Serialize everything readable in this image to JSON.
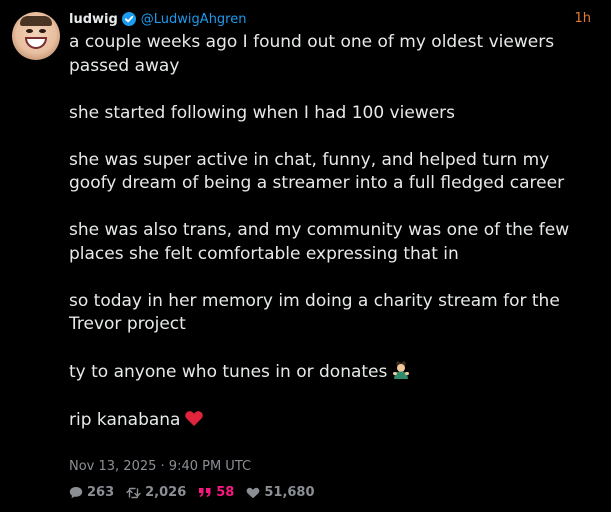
{
  "post": {
    "author_name": "ludwig",
    "author_handle": "@LudwigAhgren",
    "relative_time": "1h",
    "paragraphs": [
      "a couple weeks ago I found out one of my oldest viewers passed away",
      "she started following when I had 100 viewers",
      "she was super active in chat, funny, and helped turn my goofy dream of being a streamer into a full fledged career",
      "she was also trans, and my community was one of the few places she felt comfortable expressing that in",
      "so today in her memory im doing a charity stream for the Trevor project",
      "ty to anyone who tunes in or donates",
      "rip kanabana"
    ],
    "timestamp": "Nov 13, 2025 · 9:40 PM UTC",
    "stats": {
      "replies": "263",
      "reposts": "2,026",
      "quotes": "58",
      "likes": "51,680"
    }
  },
  "icons": {
    "verified": "verified-badge-icon",
    "person_emoji": "man-gesturing-emoji-icon",
    "heart_emoji": "red-heart-emoji-icon",
    "reply": "comment-icon",
    "repost": "repost-icon",
    "quote": "quote-icon",
    "like": "heart-icon"
  },
  "colors": {
    "background": "#000000",
    "text": "#e7e9ea",
    "muted": "#8b8f94",
    "handle": "#1d9bf0",
    "time_accent": "#e07b39",
    "quote_accent": "#f91880"
  }
}
